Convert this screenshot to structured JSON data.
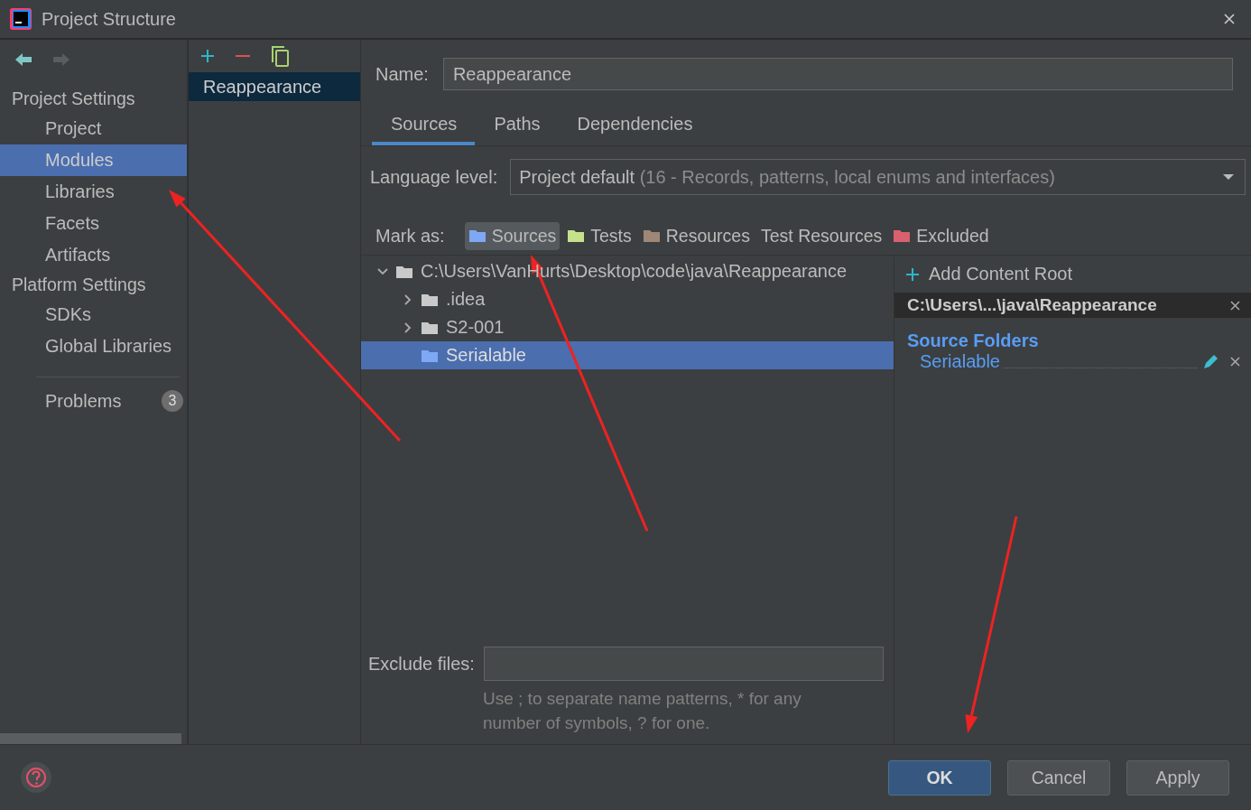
{
  "window": {
    "title": "Project Structure"
  },
  "sidebar": {
    "sections": [
      {
        "title": "Project Settings",
        "items": [
          {
            "label": "Project",
            "selected": false
          },
          {
            "label": "Modules",
            "selected": true
          },
          {
            "label": "Libraries",
            "selected": false
          },
          {
            "label": "Facets",
            "selected": false
          },
          {
            "label": "Artifacts",
            "selected": false
          }
        ]
      },
      {
        "title": "Platform Settings",
        "items": [
          {
            "label": "SDKs",
            "selected": false
          },
          {
            "label": "Global Libraries",
            "selected": false
          }
        ]
      }
    ],
    "problems": {
      "label": "Problems",
      "count": "3"
    }
  },
  "modules": [
    {
      "label": "Reappearance",
      "selected": true
    }
  ],
  "name_field": {
    "label": "Name:",
    "value": "Reappearance"
  },
  "tabs": [
    {
      "label": "Sources",
      "selected": true
    },
    {
      "label": "Paths",
      "selected": false
    },
    {
      "label": "Dependencies",
      "selected": false
    }
  ],
  "language_level": {
    "label": "Language level:",
    "value": "Project default",
    "detail": "(16 - Records, patterns, local enums and interfaces)"
  },
  "mark_as": {
    "label": "Mark as:",
    "options": [
      {
        "label": "Sources",
        "color": "#7fa8f4",
        "selected": true
      },
      {
        "label": "Tests",
        "color": "#c5e28a",
        "selected": false
      },
      {
        "label": "Resources",
        "color": "#9e8777",
        "selected": false
      },
      {
        "label": "Test Resources",
        "selected": false
      },
      {
        "label": "Excluded",
        "color": "#d9606f",
        "selected": false
      }
    ]
  },
  "tree": [
    {
      "label": "C:\\Users\\VanHurts\\Desktop\\code\\java\\Reappearance",
      "expanded": true,
      "selected": false,
      "children": [
        {
          "label": ".idea",
          "expanded": false,
          "selected": false,
          "kind": "folder"
        },
        {
          "label": "S2-001",
          "expanded": false,
          "selected": false,
          "kind": "folder"
        },
        {
          "label": "Serialable",
          "selected": true,
          "kind": "source"
        }
      ]
    }
  ],
  "content_root": {
    "add_label": "Add Content Root",
    "path": "C:\\Users\\...\\java\\Reappearance",
    "section": "Source Folders",
    "folders": [
      "Serialable"
    ]
  },
  "exclude_files": {
    "label": "Exclude files:",
    "hint": "Use ; to separate name patterns, * for any number of symbols, ? for one."
  },
  "buttons": [
    {
      "label": "OK",
      "default": true
    },
    {
      "label": "Cancel",
      "default": false
    },
    {
      "label": "Apply",
      "default": false
    }
  ],
  "annotations": [
    {
      "kind": "arrow"
    },
    {
      "kind": "arrow"
    },
    {
      "kind": "arrow"
    }
  ]
}
